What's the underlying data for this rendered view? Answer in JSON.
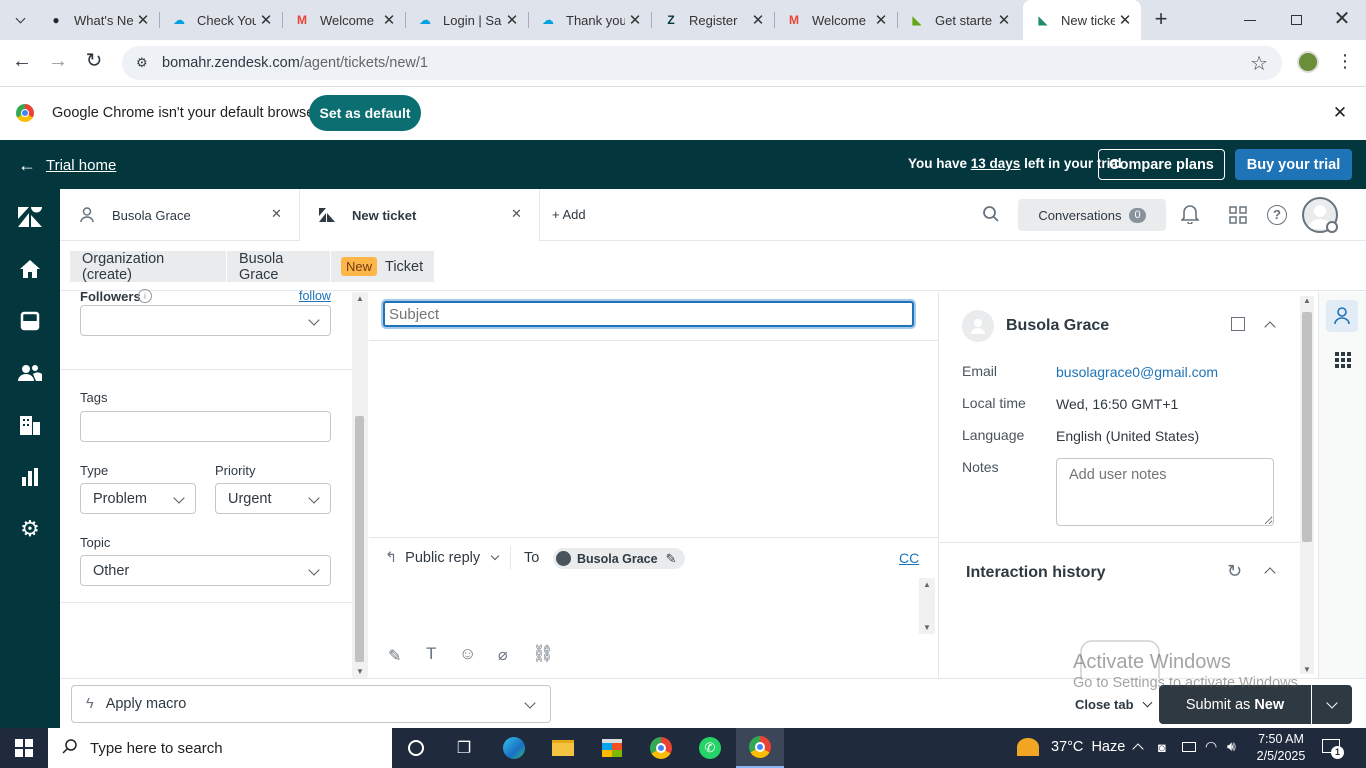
{
  "browser": {
    "tabs": [
      {
        "title": "What's Ne",
        "icon": "github-icon",
        "color": "#24292f"
      },
      {
        "title": "Check You",
        "icon": "salesforce-icon",
        "color": "#00a1e0"
      },
      {
        "title": "Welcome",
        "icon": "gmail-icon",
        "color": "#ea4335"
      },
      {
        "title": "Login | Sa",
        "icon": "salesforce-icon",
        "color": "#00a1e0"
      },
      {
        "title": "Thank you",
        "icon": "salesforce-icon",
        "color": "#00a1e0"
      },
      {
        "title": "Register",
        "icon": "zendesk-icon",
        "color": "#03363d"
      },
      {
        "title": "Welcome",
        "icon": "gmail-icon",
        "color": "#ea4335"
      },
      {
        "title": "Get starte",
        "icon": "zendesk-green-icon",
        "color": "#62a613"
      },
      {
        "title": "New ticke",
        "icon": "zendesk-green-icon",
        "color": "#1f8a70"
      }
    ],
    "url_host": "bomahr.zendesk.com",
    "url_path": "/agent/tickets/new/1"
  },
  "banner": {
    "text": "Google Chrome isn't your default browser",
    "button": "Set as default"
  },
  "trial": {
    "home": "Trial home",
    "msg_pre": "You have ",
    "msg_days": "13 days",
    "msg_post": " left in your trial",
    "compare": "Compare plans",
    "buy": "Buy your trial"
  },
  "header": {
    "tab1": "Busola Grace",
    "tab2": "New ticket",
    "add": "Add",
    "conversations": "Conversations",
    "conv_count": "0"
  },
  "breadcrumbs": {
    "org": "Organization (create)",
    "user": "Busola Grace",
    "new_badge": "New",
    "ticket": "Ticket"
  },
  "left": {
    "followers": "Followers",
    "follow": "follow",
    "tags": "Tags",
    "type_label": "Type",
    "type_value": "Problem",
    "priority_label": "Priority",
    "priority_value": "Urgent",
    "topic_label": "Topic",
    "topic_value": "Other"
  },
  "center": {
    "subject_placeholder": "Subject",
    "reply_mode": "Public reply",
    "to": "To",
    "recipient": "Busola Grace",
    "cc": "CC"
  },
  "right": {
    "name": "Busola Grace",
    "email_label": "Email",
    "email": "busolagrace0@gmail.com",
    "time_label": "Local time",
    "time": "Wed, 16:50 GMT+1",
    "lang_label": "Language",
    "lang": "English (United States)",
    "notes_label": "Notes",
    "notes_placeholder": "Add user notes",
    "interaction": "Interaction history"
  },
  "watermark": {
    "l1": "Activate Windows",
    "l2": "Go to Settings to activate Windows."
  },
  "footer": {
    "macro": "Apply macro",
    "close_tab": "Close tab",
    "submit_pre": "Submit as ",
    "submit_status": "New"
  },
  "taskbar": {
    "search": "Type here to search",
    "weather": "37°C  Haze",
    "time": "7:50 AM",
    "date": "2/5/2025",
    "notif": "1"
  }
}
